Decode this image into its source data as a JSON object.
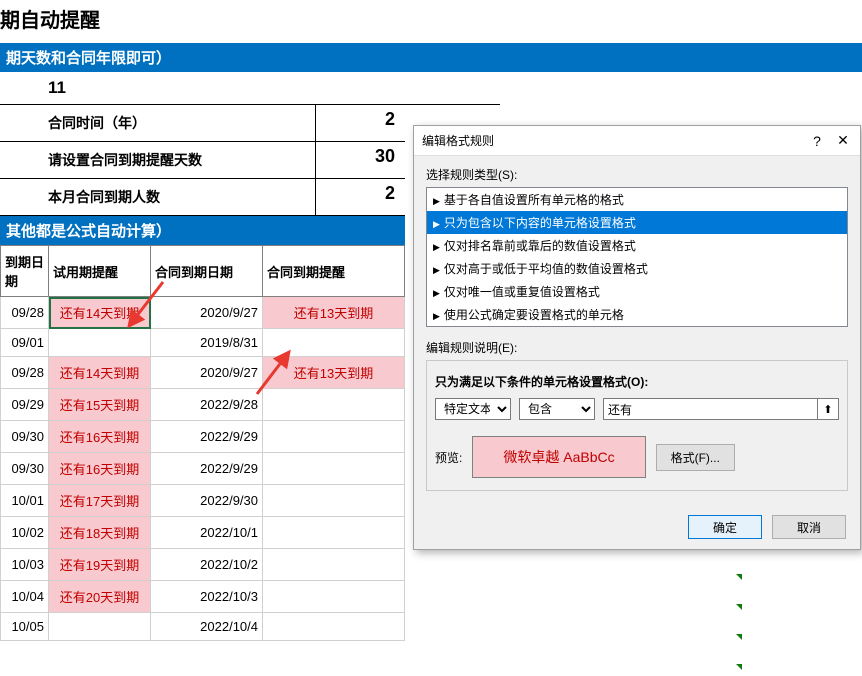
{
  "title": "期自动提醒",
  "bar1": "期天数和合同年限即可）",
  "val11": "11",
  "info": [
    {
      "label": "合同时间（年）",
      "value": "2"
    },
    {
      "label": "请设置合同到期提醒天数",
      "value": "30"
    },
    {
      "label": "本月合同到期人数",
      "value": "2"
    }
  ],
  "bar2": "其他都是公式自动计算）",
  "cols": [
    "到期日期",
    "试用期提醒",
    "合同到期日期",
    "合同到期提醒"
  ],
  "rows": [
    {
      "d": "09/28",
      "a": "还有14天到期",
      "ap": true,
      "d2": "2020/9/27",
      "a2": "还有13天到期",
      "a2p": true
    },
    {
      "d": "09/01",
      "a": "",
      "ap": false,
      "d2": "2019/8/31",
      "a2": "",
      "a2p": false
    },
    {
      "d": "09/28",
      "a": "还有14天到期",
      "ap": true,
      "d2": "2020/9/27",
      "a2": "还有13天到期",
      "a2p": true
    },
    {
      "d": "09/29",
      "a": "还有15天到期",
      "ap": true,
      "d2": "2022/9/28",
      "a2": "",
      "a2p": false
    },
    {
      "d": "09/30",
      "a": "还有16天到期",
      "ap": true,
      "d2": "2022/9/29",
      "a2": "",
      "a2p": false
    },
    {
      "d": "09/30",
      "a": "还有16天到期",
      "ap": true,
      "d2": "2022/9/29",
      "a2": "",
      "a2p": false
    },
    {
      "d": "10/01",
      "a": "还有17天到期",
      "ap": true,
      "d2": "2022/9/30",
      "a2": "",
      "a2p": false
    },
    {
      "d": "10/02",
      "a": "还有18天到期",
      "ap": true,
      "d2": "2022/10/1",
      "a2": "",
      "a2p": false
    },
    {
      "d": "10/03",
      "a": "还有19天到期",
      "ap": true,
      "d2": "2022/10/2",
      "a2": "",
      "a2p": false
    },
    {
      "d": "10/04",
      "a": "还有20天到期",
      "ap": true,
      "d2": "2022/10/3",
      "a2": "",
      "a2p": false
    },
    {
      "d": "10/05",
      "a": "",
      "ap": false,
      "d2": "2022/10/4",
      "a2": "",
      "a2p": false
    }
  ],
  "dialog": {
    "title": "编辑格式规则",
    "help": "?",
    "close": "✕",
    "selectRuleLabel": "选择规则类型(S):",
    "ruleTypes": [
      "基于各自值设置所有单元格的格式",
      "只为包含以下内容的单元格设置格式",
      "仅对排名靠前或靠后的数值设置格式",
      "仅对高于或低于平均值的数值设置格式",
      "仅对唯一值或重复值设置格式",
      "使用公式确定要设置格式的单元格"
    ],
    "ruleSelectedIndex": 1,
    "editRuleLabel": "编辑规则说明(E):",
    "conditionLabel": "只为满足以下条件的单元格设置格式(O):",
    "sel1": "特定文本",
    "sel2": "包含",
    "textValue": "还有",
    "previewLabel": "预览:",
    "previewText": "微软卓越 AaBbCc",
    "formatBtn": "格式(F)...",
    "ok": "确定",
    "cancel": "取消"
  }
}
